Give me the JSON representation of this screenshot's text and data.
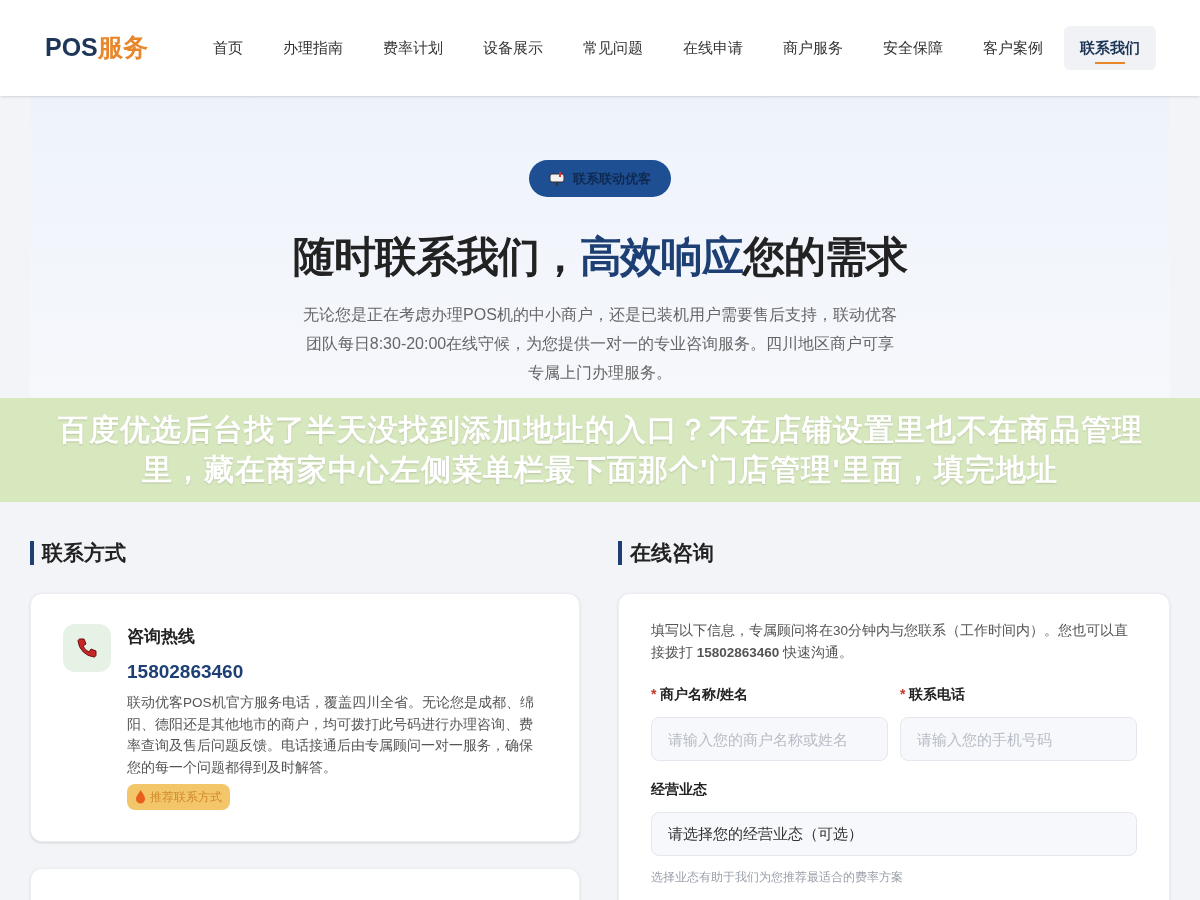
{
  "header": {
    "logo": {
      "primary": "POS",
      "accent": "服务"
    },
    "nav": [
      {
        "label": "首页",
        "selected": false
      },
      {
        "label": "办理指南",
        "selected": false
      },
      {
        "label": "费率计划",
        "selected": false
      },
      {
        "label": "设备展示",
        "selected": false
      },
      {
        "label": "常见问题",
        "selected": false
      },
      {
        "label": "在线申请",
        "selected": false
      },
      {
        "label": "商户服务",
        "selected": false
      },
      {
        "label": "安全保障",
        "selected": false
      },
      {
        "label": "客户案例",
        "selected": false
      },
      {
        "label": "联系我们",
        "selected": true
      }
    ]
  },
  "hero": {
    "badge": "联系联动优客",
    "title_parts": [
      {
        "text": "随时联系我们，",
        "highlight": false
      },
      {
        "text": "高效响应",
        "highlight": true
      },
      {
        "text": "您的需求",
        "highlight": false
      }
    ],
    "description": "无论您是正在考虑办理POS机的中小商户，还是已装机用户需要售后支持，联动优客团队每日8:30-20:00在线守候，为您提供一对一的专业咨询服务。四川地区商户可享专属上门办理服务。"
  },
  "overlay_caption": "百度优选后台找了半天没找到添加地址的入口？不在店铺设置里也不在商品管理里，藏在商家中心左侧菜单栏最下面那个'门店管理'里面，填完地址",
  "contact": {
    "heading": "联系方式",
    "cards": [
      {
        "title": "咨询热线",
        "value": "15802863460",
        "description": "联动优客POS机官方服务电话，覆盖四川全省。无论您是成都、绵阳、德阳还是其他地市的商户，均可拨打此号码进行办理咨询、费率查询及售后问题反馈。电话接通后由专属顾问一对一服务，确保您的每一个问题都得到及时解答。",
        "tag": "推荐联系方式"
      }
    ]
  },
  "consult": {
    "heading": "在线咨询",
    "intro": "填写以下信息，专属顾问将在30分钟内与您联系（工作时间内）。您也可以直接拨打 **15802863460** 快速沟通。",
    "fields": [
      {
        "kind": "input",
        "label": "商户名称/姓名",
        "required_mark": "*",
        "placeholder": "请输入您的商户名称或姓名"
      },
      {
        "kind": "input",
        "label": "联系电话",
        "required_mark": "*",
        "placeholder": "请输入您的手机号码"
      },
      {
        "kind": "select",
        "label": "经营业态",
        "value": "请选择您的经营业态（可选）",
        "hint": "选择业态有助于我们为您推荐最适合的费率方案"
      }
    ]
  }
}
